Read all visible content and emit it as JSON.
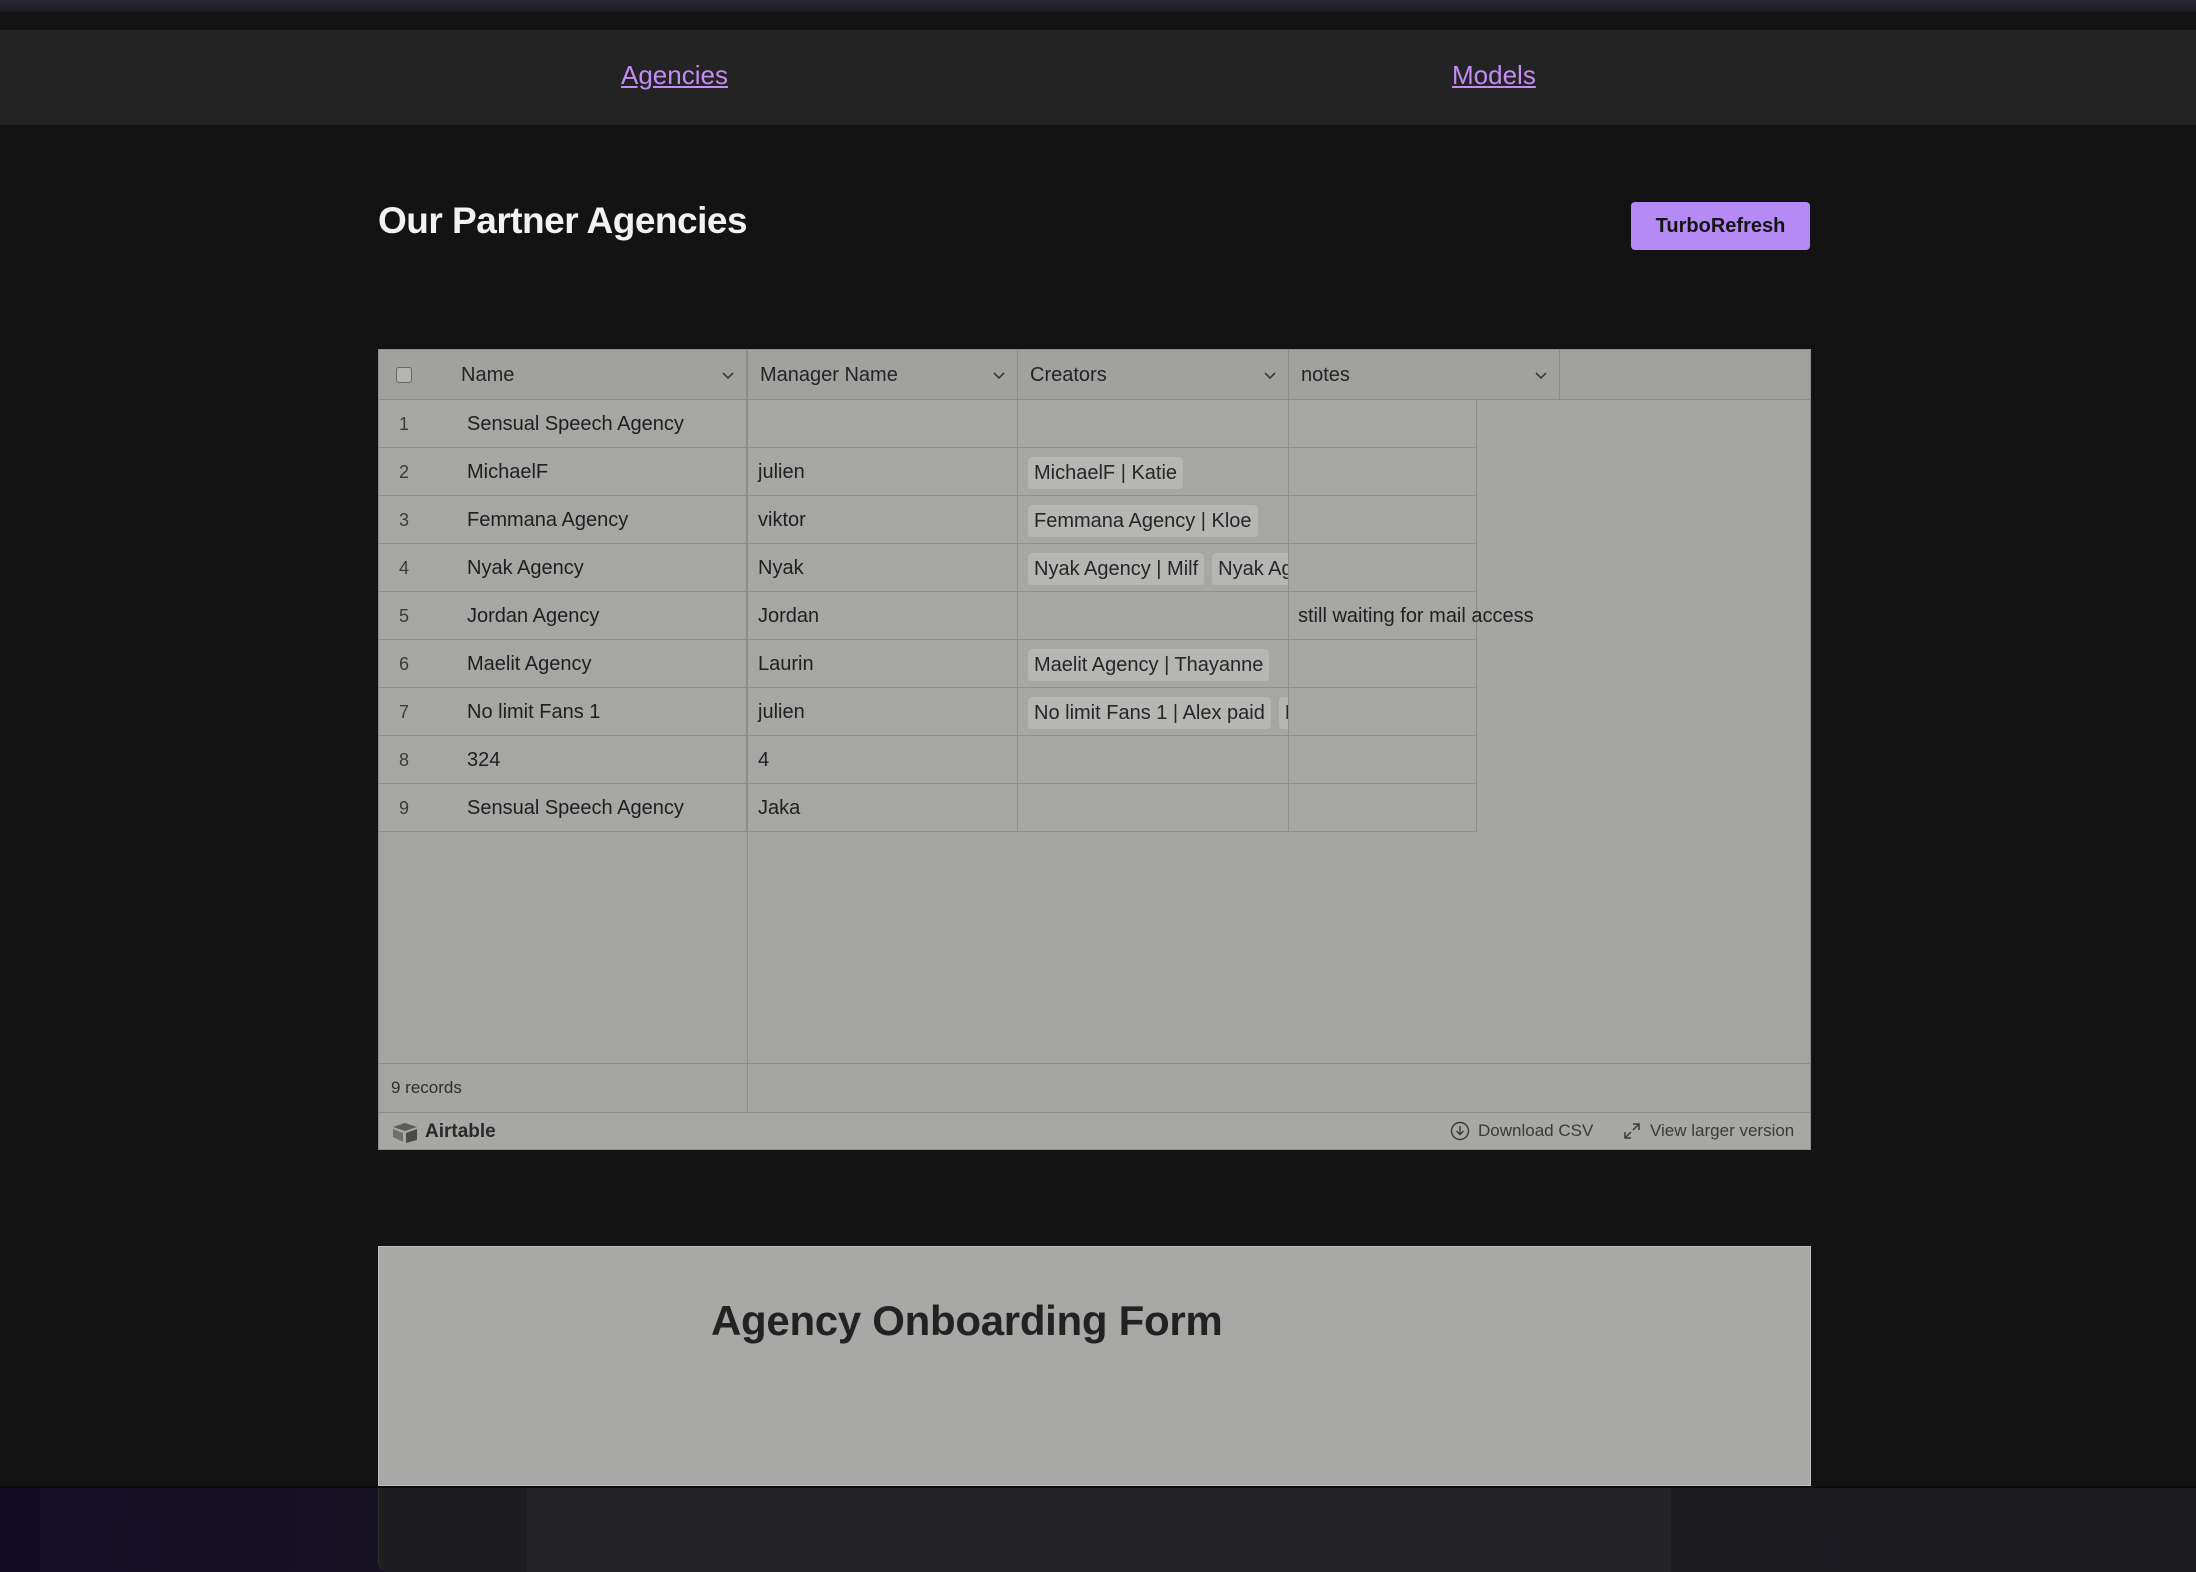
{
  "nav": {
    "agencies": "Agencies",
    "models": "Models"
  },
  "page": {
    "title": "Our Partner Agencies",
    "refresh_button": "TurboRefresh"
  },
  "table": {
    "columns": [
      "Name",
      "Manager Name",
      "Creators",
      "notes"
    ],
    "rows": [
      {
        "num": "1",
        "name": "Sensual Speech Agency",
        "manager": "",
        "creators": [],
        "notes": ""
      },
      {
        "num": "2",
        "name": "MichaelF",
        "manager": "julien",
        "creators": [
          "MichaelF | Katie"
        ],
        "notes": ""
      },
      {
        "num": "3",
        "name": "Femmana Agency",
        "manager": "viktor",
        "creators": [
          "Femmana Agency | Kloe"
        ],
        "notes": ""
      },
      {
        "num": "4",
        "name": "Nyak Agency",
        "manager": "Nyak",
        "creators": [
          "Nyak Agency | Milf",
          "Nyak Ag"
        ],
        "notes": ""
      },
      {
        "num": "5",
        "name": "Jordan Agency",
        "manager": "Jordan",
        "creators": [],
        "notes": "still waiting for mail access"
      },
      {
        "num": "6",
        "name": "Maelit Agency",
        "manager": "Laurin",
        "creators": [
          "Maelit Agency | Thayanne"
        ],
        "notes": ""
      },
      {
        "num": "7",
        "name": "No limit Fans 1",
        "manager": "julien",
        "creators": [
          "No limit Fans 1 | Alex paid",
          "N"
        ],
        "notes": ""
      },
      {
        "num": "8",
        "name": "324",
        "manager": "4",
        "creators": [],
        "notes": ""
      },
      {
        "num": "9",
        "name": "Sensual Speech Agency",
        "manager": "Jaka",
        "creators": [],
        "notes": ""
      }
    ],
    "record_count": "9 records",
    "brand": "Airtable",
    "download_csv": "Download CSV",
    "view_larger": "View larger version"
  },
  "form": {
    "title": "Agency Onboarding Form"
  },
  "colors": {
    "accent": "#b58af4",
    "link": "#c48bf5",
    "background": "#131313"
  }
}
